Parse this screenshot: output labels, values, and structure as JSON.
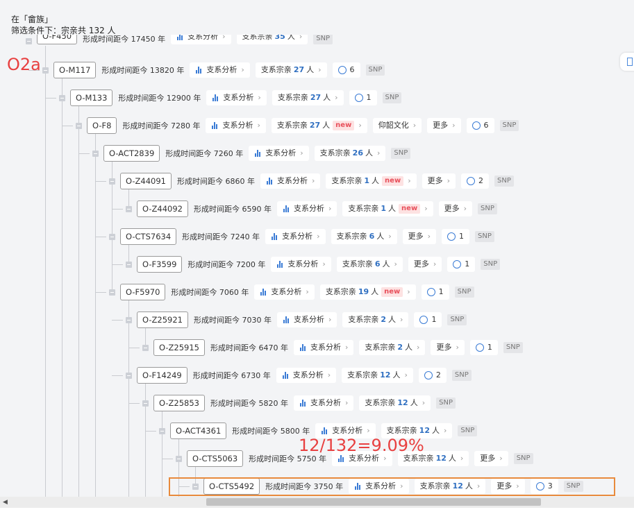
{
  "header": {
    "line1": "在「畲族」",
    "line2": "筛选条件下：宗亲共 132 人"
  },
  "overlays": {
    "o2a_label": "O2a",
    "ratio_label": "12/132=9.09%"
  },
  "labels": {
    "analysis": "支系分析",
    "clan_prefix": "支系宗亲",
    "clan_suffix": "人",
    "more": "更多",
    "snp": "SNP",
    "new": "new",
    "culture": "仰韶文化",
    "age_prefix": "形成时间距今",
    "age_suffix": "年"
  },
  "rows": [
    {
      "node": "O-F450",
      "age": "17450",
      "clan_count": "35",
      "new": false,
      "more": false,
      "culture": false,
      "chat": "",
      "cut": true
    },
    {
      "node": "O-M117",
      "age": "13820",
      "clan_count": "27",
      "new": false,
      "more": false,
      "culture": false,
      "chat": "6"
    },
    {
      "node": "O-M133",
      "age": "12900",
      "clan_count": "27",
      "new": false,
      "more": false,
      "culture": false,
      "chat": "1"
    },
    {
      "node": "O-F8",
      "age": "7280",
      "clan_count": "27",
      "new": true,
      "more": true,
      "culture": true,
      "chat": "6"
    },
    {
      "node": "O-ACT2839",
      "age": "7260",
      "clan_count": "26",
      "new": false,
      "more": false,
      "culture": false,
      "chat": ""
    },
    {
      "node": "O-Z44091",
      "age": "6860",
      "clan_count": "1",
      "new": true,
      "more": true,
      "culture": false,
      "chat": "2"
    },
    {
      "node": "O-Z44092",
      "age": "6590",
      "clan_count": "1",
      "new": true,
      "more": true,
      "culture": false,
      "chat": ""
    },
    {
      "node": "O-CTS7634",
      "age": "7240",
      "clan_count": "6",
      "new": false,
      "more": true,
      "culture": false,
      "chat": "1"
    },
    {
      "node": "O-F3599",
      "age": "7200",
      "clan_count": "6",
      "new": false,
      "more": true,
      "culture": false,
      "chat": "1"
    },
    {
      "node": "O-F5970",
      "age": "7060",
      "clan_count": "19",
      "new": true,
      "more": false,
      "culture": false,
      "chat": "1"
    },
    {
      "node": "O-Z25921",
      "age": "7030",
      "clan_count": "2",
      "new": false,
      "more": false,
      "culture": false,
      "chat": "1"
    },
    {
      "node": "O-Z25915",
      "age": "6470",
      "clan_count": "2",
      "new": false,
      "more": true,
      "culture": false,
      "chat": "1"
    },
    {
      "node": "O-F14249",
      "age": "6730",
      "clan_count": "12",
      "new": false,
      "more": false,
      "culture": false,
      "chat": "2"
    },
    {
      "node": "O-Z25853",
      "age": "5820",
      "clan_count": "12",
      "new": false,
      "more": false,
      "culture": false,
      "chat": ""
    },
    {
      "node": "O-ACT4361",
      "age": "5800",
      "clan_count": "12",
      "new": false,
      "more": false,
      "culture": false,
      "chat": ""
    },
    {
      "node": "O-CTS5063",
      "age": "5750",
      "clan_count": "12",
      "new": false,
      "more": true,
      "culture": false,
      "chat": ""
    },
    {
      "node": "O-CTS5492",
      "age": "3750",
      "clan_count": "12",
      "new": false,
      "more": true,
      "culture": false,
      "chat": "3"
    }
  ],
  "colors": {
    "accent": "#3a7bd5",
    "new_badge": "#e8505b",
    "highlight_box": "#e88a3c",
    "overlay_text": "#e84040"
  }
}
